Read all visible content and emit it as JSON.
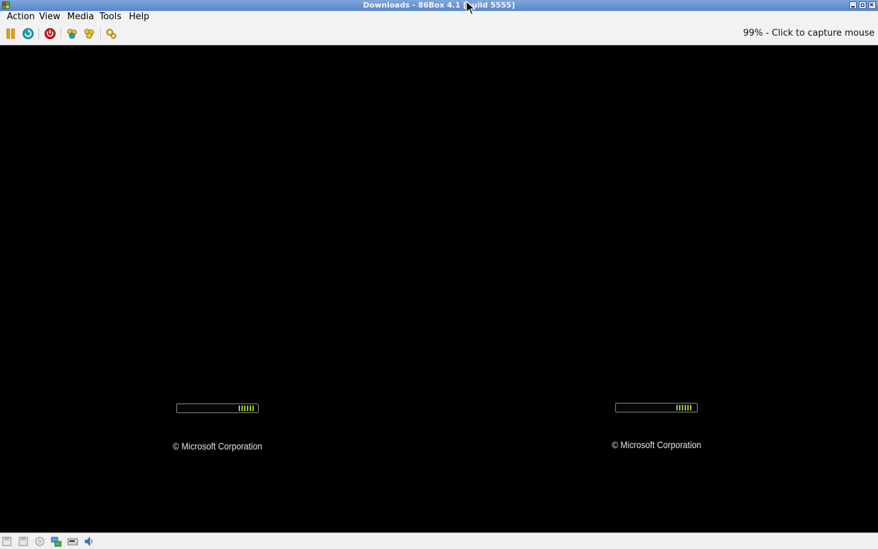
{
  "window": {
    "title": "Downloads - 86Box 4.1 [build 5555]",
    "icon": "86box-app-icon",
    "controls": [
      "minimize-icon",
      "maximize-icon",
      "close-icon"
    ]
  },
  "menu": [
    {
      "label": "Action",
      "accel": "A"
    },
    {
      "label": "View",
      "accel": "V"
    },
    {
      "label": "Media",
      "accel": "M"
    },
    {
      "label": "Tools",
      "accel": "T"
    },
    {
      "label": "Help",
      "accel": "H"
    }
  ],
  "toolbar": {
    "buttons": [
      "pause-icon",
      "hard-reset-icon",
      "acpi-shutdown-icon",
      "ctrl-alt-del-icon",
      "ctrl-alt-esc-icon",
      "settings-icon"
    ],
    "status": "99% - Click to capture mouse"
  },
  "screen": {
    "boot_screens": [
      {
        "copyright": "© Microsoft Corporation"
      },
      {
        "copyright": "© Microsoft Corporation"
      }
    ],
    "progress_color": "#9ccf3b"
  },
  "statusbar": {
    "icons": [
      "floppy-a-icon",
      "floppy-b-icon",
      "cdrom-icon",
      "network-icon",
      "hard-disk-icon",
      "sound-icon"
    ]
  },
  "colors": {
    "titlebar": "#5a86c9",
    "background": "#000000"
  }
}
